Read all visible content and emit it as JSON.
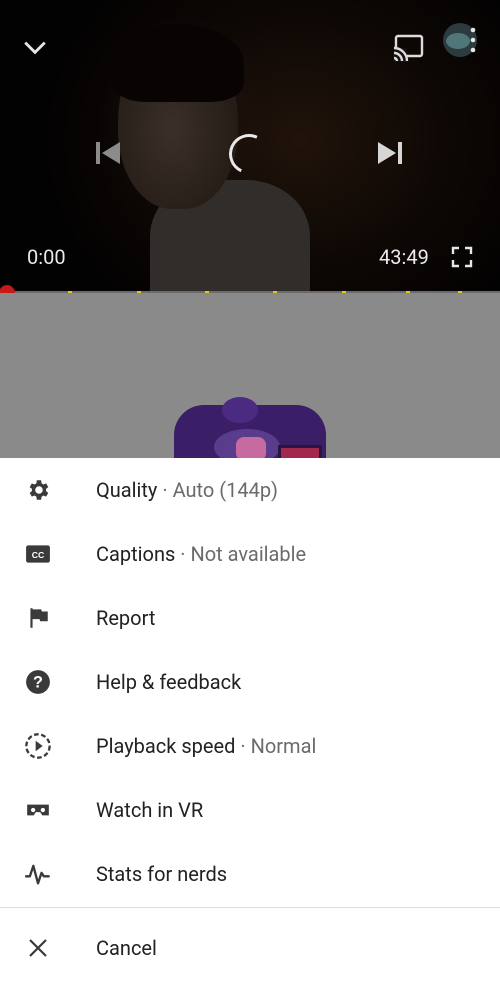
{
  "player": {
    "current_time": "0:00",
    "duration": "43:49",
    "chapter_marks": 8,
    "progress_fraction": 0.0
  },
  "menu": {
    "items": [
      {
        "label": "Quality",
        "sub": "Auto (144p)",
        "icon": "gear-icon"
      },
      {
        "label": "Captions",
        "sub": "Not available",
        "icon": "cc-icon"
      },
      {
        "label": "Report",
        "sub": "",
        "icon": "flag-icon"
      },
      {
        "label": "Help & feedback",
        "sub": "",
        "icon": "help-icon"
      },
      {
        "label": "Playback speed",
        "sub": "Normal",
        "icon": "playback-speed-icon"
      },
      {
        "label": "Watch in VR",
        "sub": "",
        "icon": "vr-headset-icon"
      },
      {
        "label": "Stats for nerds",
        "sub": "",
        "icon": "stats-pulse-icon"
      }
    ],
    "cancel_label": "Cancel"
  },
  "separator": "·"
}
